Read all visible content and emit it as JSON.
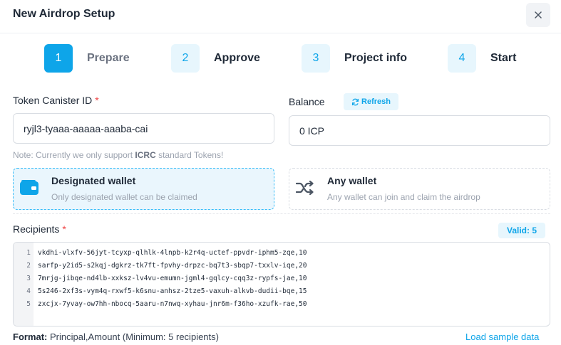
{
  "modal": {
    "title": "New Airdrop Setup",
    "close_icon": "close-icon"
  },
  "steps": [
    {
      "number": "1",
      "label": "Prepare",
      "state": "active"
    },
    {
      "number": "2",
      "label": "Approve",
      "state": "pending"
    },
    {
      "number": "3",
      "label": "Project info",
      "state": "pending"
    },
    {
      "number": "4",
      "label": "Start",
      "state": "pending"
    }
  ],
  "token": {
    "label": "Token Canister ID",
    "required_mark": "*",
    "value": "ryjl3-tyaaa-aaaaa-aaaba-cai",
    "note_prefix": "Note: Currently we only support ",
    "note_bold": "ICRC",
    "note_suffix": " standard Tokens!"
  },
  "balance": {
    "label": "Balance",
    "refresh_label": "Refresh",
    "refresh_icon": "refresh-icon",
    "value": "0 ICP"
  },
  "wallet_options": [
    {
      "title": "Designated wallet",
      "subtitle": "Only designated wallet can be claimed",
      "icon": "wallet-icon",
      "selected": true
    },
    {
      "title": "Any wallet",
      "subtitle": "Any wallet can join and claim the airdrop",
      "icon": "shuffle-icon",
      "selected": false
    }
  ],
  "recipients": {
    "label": "Recipients",
    "required_mark": "*",
    "valid_badge": "Valid: 5",
    "lines": [
      {
        "num": "1",
        "text": "vkdhi-vlxfv-56jyt-tcyxp-qlhlk-4lnpb-k2r4q-uctef-ppvdr-iphm5-zqe,10"
      },
      {
        "num": "2",
        "text": "sarfp-y2id5-s2kqj-dgkrz-tk7ft-fpvhy-drpzc-bq7t3-sbqp7-txxlv-iqe,20"
      },
      {
        "num": "3",
        "text": "7mrjg-jibqe-nd4lb-xxksz-lv4vu-emumn-jgml4-gqlcy-cqq3z-rypfs-jae,10"
      },
      {
        "num": "4",
        "text": "5s246-2xf3s-vym4q-rxwf5-k6snu-anhsz-2tze5-vaxuh-alkvb-dudii-bqe,15"
      },
      {
        "num": "5",
        "text": "zxcjx-7yvay-ow7hh-nbocq-5aaru-n7nwq-xyhau-jnr6m-f36ho-xzufk-rae,50"
      }
    ]
  },
  "footer": {
    "format_bold": "Format:",
    "format_text": " Principal,Amount (Minimum: 5 recipients)",
    "load_sample": "Load sample data"
  },
  "colors": {
    "accent": "#0ea5e9",
    "accent_light": "#e7f6fd",
    "required": "#ef4444"
  }
}
